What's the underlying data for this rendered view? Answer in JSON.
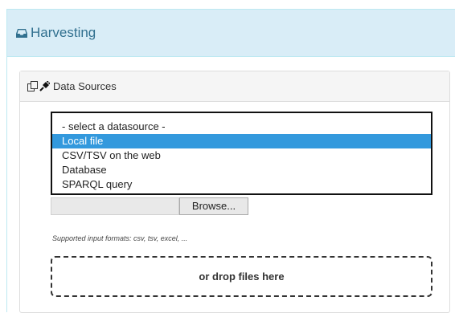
{
  "header": {
    "title": "Harvesting",
    "icon": "inbox-icon",
    "accent": "#31708f",
    "background": "#d9edf7"
  },
  "data_sources": {
    "title": "Data Sources",
    "icons": [
      "copy-icon",
      "plug-icon"
    ],
    "options": [
      {
        "label": "- select a datasource -",
        "selected": false
      },
      {
        "label": "Local file",
        "selected": true
      },
      {
        "label": "CSV/TSV on the web",
        "selected": false
      },
      {
        "label": "Database",
        "selected": false
      },
      {
        "label": "SPARQL query",
        "selected": false
      }
    ],
    "selected_color": "#3399dd",
    "browse_label": "Browse...",
    "supported_formats": "Supported input formats: csv, tsv, excel, ...",
    "drop_label": "or drop files here"
  }
}
